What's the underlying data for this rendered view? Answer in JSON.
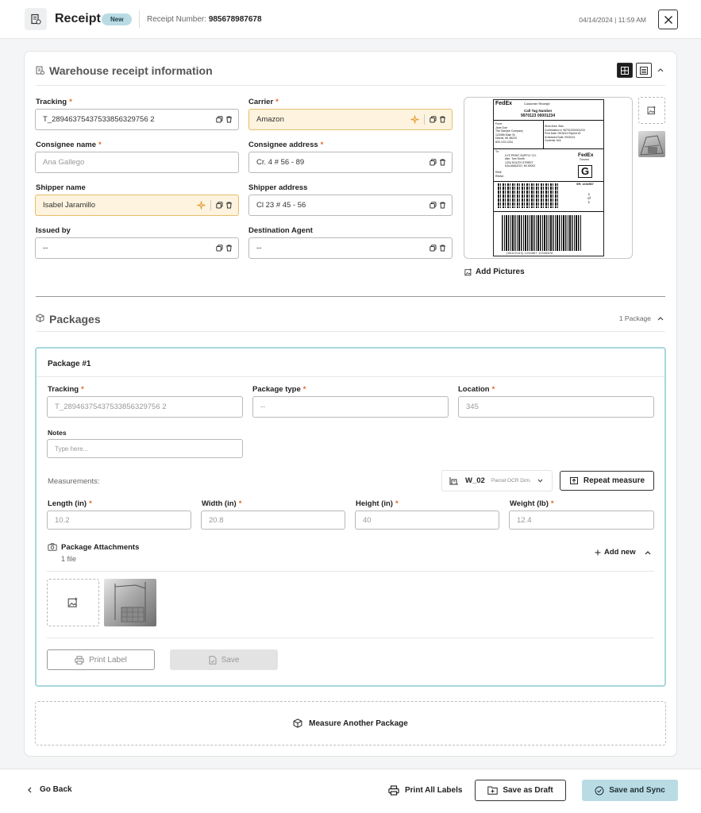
{
  "header": {
    "title": "Receipt",
    "badge": "New",
    "receipt_number_label": "Receipt Number:",
    "receipt_number": "985678987678",
    "datetime": "04/14/2024 | 11:59 AM"
  },
  "warehouse": {
    "title": "Warehouse receipt information",
    "fields": {
      "tracking": {
        "label": "Tracking",
        "value": "T_28946375437533856329756 2"
      },
      "carrier": {
        "label": "Carrier",
        "value": "Amazon"
      },
      "consignee_name": {
        "label": "Consignee name",
        "value": "Ana Gallego"
      },
      "consignee_address": {
        "label": "Consignee address",
        "value": "Cr. 4 # 56 - 89"
      },
      "shipper_name": {
        "label": "Shipper name",
        "value": "Isabel Jaramillo"
      },
      "shipper_address": {
        "label": "Shipper address",
        "value": "Cl 23 # 45 - 56"
      },
      "issued_by": {
        "label": "Issued by",
        "value": "--"
      },
      "destination_agent": {
        "label": "Destination Agent",
        "value": "--"
      }
    },
    "add_pictures": "Add Pictures",
    "label_image": {
      "carrier_logo": "FedEx",
      "header": "Customer Receipt:",
      "title": "Call Tag Number",
      "number": "9970123  00001234",
      "from_block": [
        "From:",
        "Jane Doe",
        "The Sample Company",
        "123456 Main St.",
        "Detroit, MI 48223",
        "800-123-1234"
      ],
      "work_block": [
        "Work Area:  Stan",
        "Confirmation #: 987912300001234",
        "Print Date: 09/26/14  Reprint #2",
        "Scheduled Date:  09/30/14",
        "Contents:  N/A"
      ],
      "to_block": [
        "To:",
        "XYZ PRINT SUPPLY CO.",
        "Attn: Tom Smith",
        "1234 SOUTH STREET",
        "KALAMAZOO, MI 49002"
      ],
      "refs": [
        "Ref#:",
        "RMA#:"
      ],
      "fedex_ground": "FedEx",
      "ground_sub": "Ground",
      "ground_letter": "G",
      "sr": "SR: 1234567",
      "count": [
        "1",
        "of",
        "1"
      ],
      "barcode_text": "(96122143) 1234567  12345678"
    }
  },
  "packages": {
    "title": "Packages",
    "count": "1 Package",
    "package": {
      "title": "Package #1",
      "tracking": {
        "label": "Tracking",
        "placeholder": "T_28946375437533856329756 2"
      },
      "package_type": {
        "label": "Package type",
        "placeholder": "--"
      },
      "location": {
        "label": "Location",
        "placeholder": "345"
      },
      "notes": {
        "label": "Notes",
        "placeholder": "Type here..."
      },
      "measurements_label": "Measurements:",
      "device": {
        "name": "W_02",
        "sub": "Parcel OCR Dim."
      },
      "repeat_measure": "Repeat measure",
      "length": {
        "label": "Length (in)",
        "placeholder": "10.2"
      },
      "width": {
        "label": "Width (in)",
        "placeholder": "20.8"
      },
      "height": {
        "label": "Height (in)",
        "placeholder": "40"
      },
      "weight": {
        "label": "Weight (lb)",
        "placeholder": "12.4"
      },
      "attachments": {
        "title": "Package Attachments",
        "count": "1 file",
        "add_new": "Add new"
      },
      "print_label": "Print Label",
      "save": "Save"
    },
    "measure_another": "Measure Another Package"
  },
  "footer": {
    "go_back": "Go Back",
    "print_all": "Print All Labels",
    "save_draft": "Save as Draft",
    "save_sync": "Save and Sync"
  },
  "colors": {
    "required": "#e26a2c",
    "highlight_bg": "#fdf3de",
    "highlight_border": "#e6be6b",
    "badge": "#b9dbe4",
    "package_border": "#a8d7df",
    "sync_button": "#b9dbe4"
  }
}
